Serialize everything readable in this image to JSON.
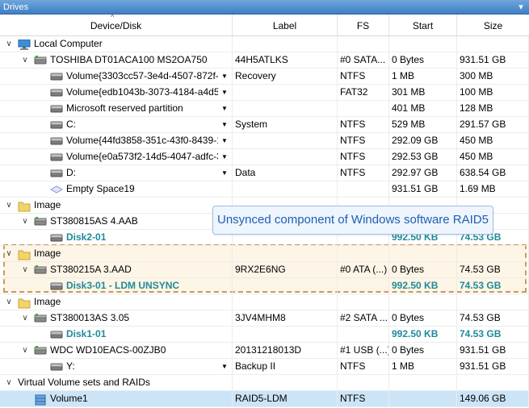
{
  "window": {
    "title": "Drives",
    "pin_glyph": "▾"
  },
  "columns": {
    "device": "Device/Disk",
    "label": "Label",
    "fs": "FS",
    "start": "Start",
    "size": "Size"
  },
  "tooltip": "Unsynced component of Windows software RAID5",
  "rows": [
    {
      "name": "Local Computer",
      "label": "",
      "fs": "",
      "start": "",
      "size": "",
      "icon": "computer-icon",
      "expander": "∨"
    },
    {
      "name": "TOSHIBA DT01ACA100 MS2OA750",
      "label": "44H5ATLKS",
      "fs": "#0 SATA...",
      "start": "0 Bytes",
      "size": "931.51 GB",
      "icon": "hard-drive-icon",
      "expander": "∨"
    },
    {
      "name": "Volume{3303cc57-3e4d-4507-872f-...",
      "label": "Recovery",
      "fs": "NTFS",
      "start": "1 MB",
      "size": "300 MB",
      "icon": "volume-icon",
      "dropdown": "▼"
    },
    {
      "name": "Volume{edb1043b-3073-4184-a4d5-...",
      "label": "",
      "fs": "FAT32",
      "start": "301 MB",
      "size": "100 MB",
      "icon": "volume-icon",
      "dropdown": "▼"
    },
    {
      "name": "Microsoft reserved partition",
      "label": "",
      "fs": "",
      "start": "401 MB",
      "size": "128 MB",
      "icon": "volume-icon",
      "dropdown": "▼"
    },
    {
      "name": "C:",
      "label": "System",
      "fs": "NTFS",
      "start": "529 MB",
      "size": "291.57 GB",
      "icon": "volume-icon",
      "dropdown": "▼"
    },
    {
      "name": "Volume{44fd3858-351c-43f0-8439-1...",
      "label": "",
      "fs": "NTFS",
      "start": "292.09 GB",
      "size": "450 MB",
      "icon": "volume-icon",
      "dropdown": "▼"
    },
    {
      "name": "Volume{e0a573f2-14d5-4047-adfc-3...",
      "label": "",
      "fs": "NTFS",
      "start": "292.53 GB",
      "size": "450 MB",
      "icon": "volume-icon",
      "dropdown": "▼"
    },
    {
      "name": "D:",
      "label": "Data",
      "fs": "NTFS",
      "start": "292.97 GB",
      "size": "638.54 GB",
      "icon": "volume-icon",
      "dropdown": "▼"
    },
    {
      "name": "Empty Space19",
      "label": "",
      "fs": "",
      "start": "931.51 GB",
      "size": "1.69 MB",
      "icon": "empty-space-icon"
    },
    {
      "name": "Image",
      "label": "",
      "fs": "",
      "start": "",
      "size": "",
      "icon": "folder-icon",
      "expander": "∨"
    },
    {
      "name": "ST380815AS 4.AAB",
      "label": "",
      "fs": "",
      "start": "",
      "size": "",
      "icon": "hard-drive-icon",
      "expander": "∨"
    },
    {
      "name": "Disk2-01",
      "label": "",
      "fs": "",
      "start": "992.50 KB",
      "size": "74.53 GB",
      "icon": "volume-icon",
      "teal": true
    },
    {
      "name": "Image",
      "label": "",
      "fs": "",
      "start": "",
      "size": "",
      "icon": "folder-icon",
      "expander": "∨"
    },
    {
      "name": "ST380215A 3.AAD",
      "label": "9RX2E6NG",
      "fs": "#0 ATA (...)",
      "start": "0 Bytes",
      "size": "74.53 GB",
      "icon": "hard-drive-icon",
      "expander": "∨"
    },
    {
      "name": "Disk3-01 - LDM UNSYNC",
      "label": "",
      "fs": "",
      "start": "992.50 KB",
      "size": "74.53 GB",
      "icon": "volume-icon",
      "teal": true
    },
    {
      "name": "Image",
      "label": "",
      "fs": "",
      "start": "",
      "size": "",
      "icon": "folder-icon",
      "expander": "∨"
    },
    {
      "name": "ST380013AS 3.05",
      "label": "3JV4MHM8",
      "fs": "#2 SATA ...",
      "start": "0 Bytes",
      "size": "74.53 GB",
      "icon": "hard-drive-icon",
      "expander": "∨"
    },
    {
      "name": "Disk1-01",
      "label": "",
      "fs": "",
      "start": "992.50 KB",
      "size": "74.53 GB",
      "icon": "volume-icon",
      "teal": true
    },
    {
      "name": "WDC WD10EACS-00ZJB0",
      "label": "20131218013D",
      "fs": "#1 USB (...)",
      "start": "0 Bytes",
      "size": "931.51 GB",
      "icon": "hard-drive-icon",
      "expander": "∨"
    },
    {
      "name": "Y:",
      "label": "Backup II",
      "fs": "NTFS",
      "start": "1 MB",
      "size": "931.51 GB",
      "icon": "volume-icon",
      "dropdown": "▼"
    },
    {
      "name": "Virtual Volume sets and RAIDs",
      "label": "",
      "fs": "",
      "start": "",
      "size": "",
      "icon": "",
      "expander": "∨"
    },
    {
      "name": "Volume1",
      "label": "RAID5-LDM",
      "fs": "NTFS",
      "start": "",
      "size": "149.06 GB",
      "icon": "raid-volume-icon",
      "selected": true
    }
  ]
}
